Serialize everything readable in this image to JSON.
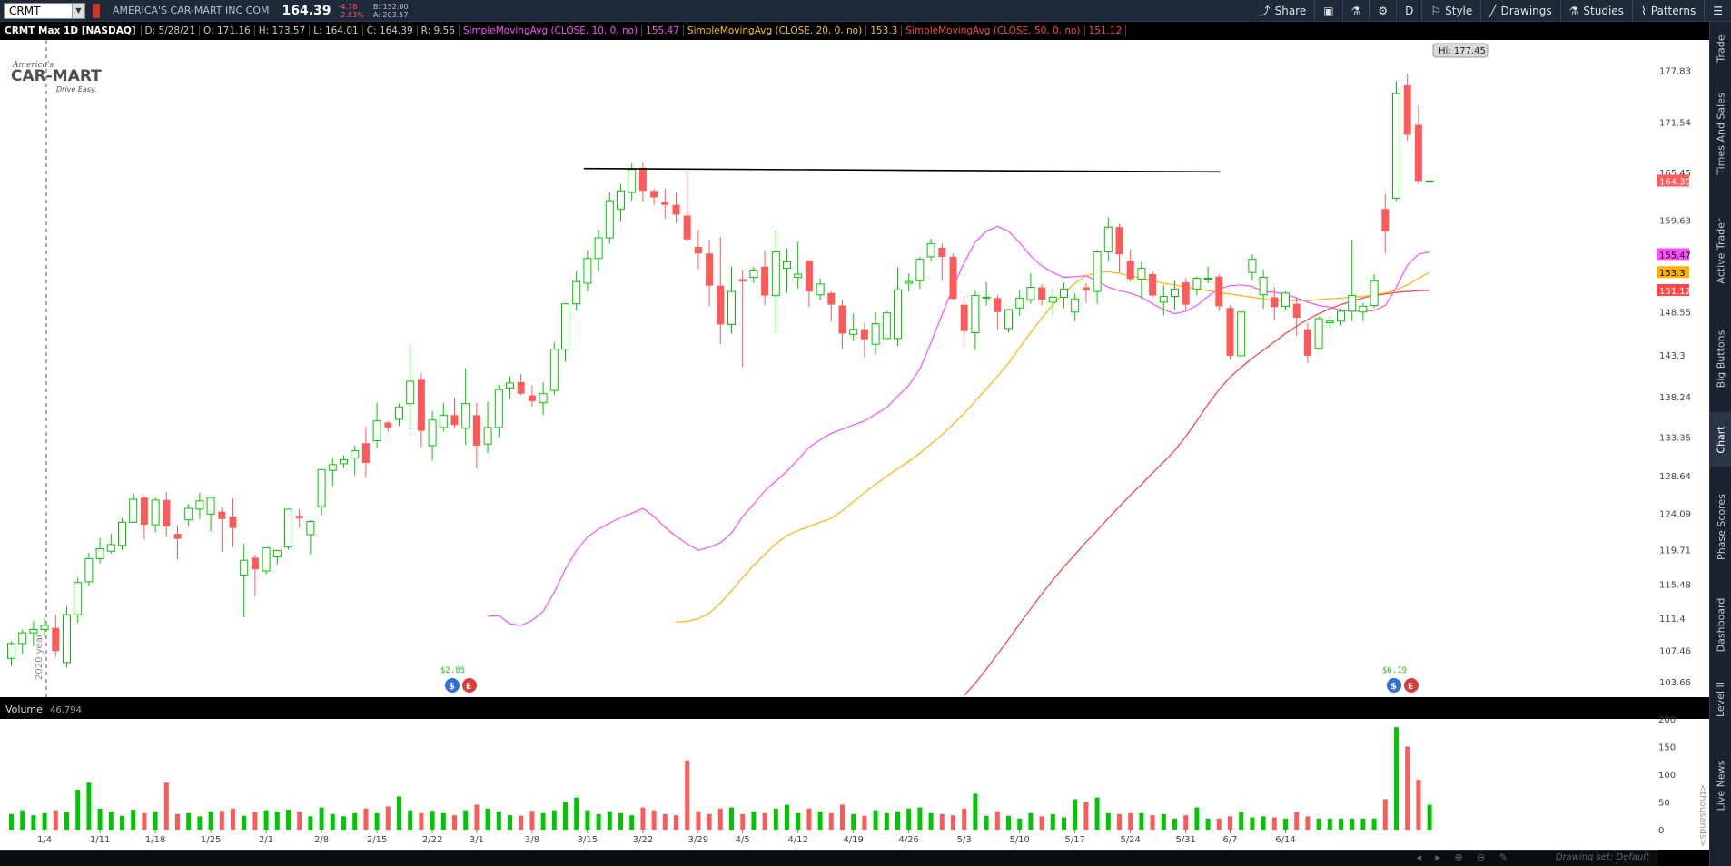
{
  "header": {
    "symbol": "CRMT",
    "company": "AMERICA'S CAR-MART INC COM",
    "last": "164.39",
    "change": "-4.78",
    "change_pct": "-2.83%",
    "bid": "B: 152.00",
    "ask": "A: 203.57"
  },
  "toolbar": [
    {
      "label": "Share",
      "icon": "share-icon"
    },
    {
      "label": "",
      "icon": "camera-icon"
    },
    {
      "label": "",
      "icon": "flask-icon"
    },
    {
      "label": "",
      "icon": "gear-icon"
    },
    {
      "label": "D",
      "icon": ""
    },
    {
      "label": "Style",
      "icon": "style-icon"
    },
    {
      "label": "Drawings",
      "icon": "pencil-icon"
    },
    {
      "label": "Studies",
      "icon": "flask-icon"
    },
    {
      "label": "Patterns",
      "icon": "patterns-icon"
    },
    {
      "label": "",
      "icon": "menu-icon"
    }
  ],
  "study_line": {
    "title": "CRMT Max 1D [NASDAQ]",
    "date": "D: 5/28/21",
    "open": "O: 171.16",
    "high": "H: 173.57",
    "low": "L: 164.01",
    "close": "C: 164.39",
    "range": "R: 9.56",
    "sma10_label": "SimpleMovingAvg (CLOSE, 10, 0, no)",
    "sma10_value": "155.47",
    "sma20_label": "SimpleMovingAvg (CLOSE, 20, 0, no)",
    "sma20_value": "153.3",
    "sma50_label": "SimpleMovingAvg (CLOSE, 50, 0, no)",
    "sma50_value": "151.12"
  },
  "side_tabs": [
    "Trade",
    "Times And Sales",
    "Active Trader",
    "Big Buttons",
    "Chart",
    "Phase Scores",
    "Dashboard",
    "Level II",
    "Live News"
  ],
  "logo": {
    "top": "America's",
    "main": "CAR-MART",
    "tag": "Drive Easy."
  },
  "hi_callout": "Hi: 177.45",
  "year_label": "2020 year",
  "dividend_left": "$2.85",
  "dividend_right": "$6.19",
  "volume_label": "Volume",
  "volume_value": "46,794",
  "volume_unit": "<thousands>",
  "drawing_set": "Drawing set: Default",
  "colors": {
    "up": "#00c800",
    "down": "#ff5a5a",
    "sma10": "#ff4dff",
    "sma20": "#ffb300",
    "sma50": "#ff3c3c"
  },
  "chart_data": {
    "type": "candlestick",
    "price_axis_ticks": [
      177.83,
      171.54,
      165.45,
      159.63,
      153.3,
      148.55,
      143.3,
      138.24,
      133.35,
      128.64,
      124.09,
      119.71,
      115.48,
      111.4,
      107.46,
      103.66
    ],
    "price_ylim": [
      101.8,
      181.5
    ],
    "volume_ticks": [
      200,
      150,
      100,
      50,
      0
    ],
    "volume_ylim": [
      0,
      200
    ],
    "x_ticks": [
      {
        "label": "1/4",
        "i": 3
      },
      {
        "label": "1/11",
        "i": 8
      },
      {
        "label": "1/18",
        "i": 13
      },
      {
        "label": "1/25",
        "i": 18
      },
      {
        "label": "2/1",
        "i": 23
      },
      {
        "label": "2/8",
        "i": 28
      },
      {
        "label": "2/15",
        "i": 33
      },
      {
        "label": "2/22",
        "i": 38
      },
      {
        "label": "3/1",
        "i": 42
      },
      {
        "label": "3/8",
        "i": 47
      },
      {
        "label": "3/15",
        "i": 52
      },
      {
        "label": "3/22",
        "i": 57
      },
      {
        "label": "3/29",
        "i": 62
      },
      {
        "label": "4/5",
        "i": 66
      },
      {
        "label": "4/12",
        "i": 71
      },
      {
        "label": "4/19",
        "i": 76
      },
      {
        "label": "4/26",
        "i": 81
      },
      {
        "label": "5/3",
        "i": 86
      },
      {
        "label": "5/10",
        "i": 91
      },
      {
        "label": "5/17",
        "i": 96
      },
      {
        "label": "5/24",
        "i": 101
      },
      {
        "label": "5/31",
        "i": 106
      },
      {
        "label": "6/7",
        "i": 110
      },
      {
        "label": "6/14",
        "i": 115
      }
    ],
    "candles": [
      [
        106.5,
        108.6,
        105.6,
        108.3,
        28
      ],
      [
        108.3,
        110.0,
        107.0,
        109.6,
        35
      ],
      [
        109.6,
        111.0,
        108.0,
        110.0,
        26
      ],
      [
        110.0,
        111.3,
        109.1,
        110.5,
        30
      ],
      [
        110.2,
        111.8,
        106.7,
        107.4,
        35
      ],
      [
        106.0,
        112.8,
        105.4,
        111.8,
        32
      ],
      [
        111.8,
        116.3,
        110.8,
        115.7,
        72
      ],
      [
        115.8,
        119.3,
        115.3,
        118.6,
        85
      ],
      [
        118.6,
        121.1,
        118.0,
        119.8,
        38
      ],
      [
        119.5,
        121.6,
        119.2,
        120.3,
        33
      ],
      [
        120.2,
        123.5,
        119.6,
        123.0,
        25
      ],
      [
        123.0,
        126.5,
        123.0,
        125.8,
        36
      ],
      [
        126.0,
        126.2,
        120.9,
        122.7,
        30
      ],
      [
        122.7,
        126.0,
        121.8,
        125.7,
        33
      ],
      [
        125.7,
        126.7,
        121.2,
        122.5,
        85
      ],
      [
        121.6,
        122.6,
        118.5,
        121.0,
        28
      ],
      [
        123.3,
        125.2,
        122.5,
        124.7,
        30
      ],
      [
        124.6,
        126.6,
        123.4,
        125.6,
        24
      ],
      [
        124.0,
        126.0,
        121.9,
        126.0,
        33
      ],
      [
        124.3,
        124.8,
        119.4,
        123.4,
        34
      ],
      [
        123.7,
        125.9,
        120.0,
        122.3,
        38
      ],
      [
        116.6,
        120.4,
        111.5,
        118.4,
        25
      ],
      [
        118.7,
        119.1,
        114.0,
        117.3,
        32
      ],
      [
        117.1,
        119.9,
        116.7,
        119.9,
        35
      ],
      [
        118.8,
        119.6,
        117.9,
        119.6,
        33
      ],
      [
        120.0,
        124.6,
        119.7,
        124.6,
        36
      ],
      [
        123.8,
        124.6,
        122.3,
        123.5,
        33
      ],
      [
        121.5,
        123.3,
        119.1,
        123.1,
        24
      ],
      [
        124.9,
        129.4,
        123.9,
        129.4,
        40
      ],
      [
        129.3,
        130.8,
        127.4,
        130.0,
        28
      ],
      [
        130.1,
        131.1,
        129.6,
        130.6,
        24
      ],
      [
        130.8,
        132.3,
        128.7,
        131.7,
        30
      ],
      [
        132.6,
        134.6,
        128.4,
        130.2,
        38
      ],
      [
        132.9,
        137.5,
        132.0,
        135.3,
        30
      ],
      [
        135.1,
        135.3,
        134.0,
        134.5,
        42
      ],
      [
        135.5,
        137.4,
        134.7,
        137.0,
        60
      ],
      [
        137.4,
        144.5,
        134.2,
        140.1,
        35
      ],
      [
        140.3,
        141.1,
        132.1,
        134.1,
        30
      ],
      [
        132.3,
        136.5,
        130.5,
        135.4,
        34
      ],
      [
        134.5,
        137.5,
        134.0,
        136.0,
        30
      ],
      [
        136.0,
        138.1,
        134.4,
        134.8,
        26
      ],
      [
        134.4,
        141.6,
        132.4,
        137.4,
        35
      ],
      [
        136.0,
        137.5,
        129.5,
        132.3,
        45
      ],
      [
        132.5,
        137.6,
        131.4,
        134.5,
        38
      ],
      [
        134.5,
        139.7,
        133.3,
        139.1,
        33
      ],
      [
        139.3,
        140.7,
        138.0,
        139.9,
        26
      ],
      [
        140.0,
        141.0,
        138.4,
        138.6,
        25
      ],
      [
        138.4,
        139.6,
        137.0,
        137.7,
        34
      ],
      [
        137.5,
        140.0,
        136.0,
        138.6,
        30
      ],
      [
        139.0,
        144.8,
        138.5,
        144.0,
        35
      ],
      [
        144.0,
        149.5,
        142.5,
        149.5,
        50
      ],
      [
        149.5,
        153.5,
        148.7,
        152.2,
        58
      ],
      [
        152.0,
        156.0,
        151.0,
        155.0,
        35
      ],
      [
        155.0,
        158.5,
        153.5,
        157.5,
        28
      ],
      [
        157.5,
        163.0,
        156.8,
        162.0,
        33
      ],
      [
        161.0,
        164.0,
        159.5,
        163.2,
        30
      ],
      [
        163.0,
        166.5,
        162.0,
        165.8,
        26
      ],
      [
        166.0,
        166.6,
        161.9,
        163.2,
        40
      ],
      [
        163.2,
        163.5,
        161.5,
        162.4,
        35
      ],
      [
        161.8,
        163.5,
        159.8,
        161.5,
        28
      ],
      [
        161.5,
        163.0,
        159.3,
        160.3,
        26
      ],
      [
        160.2,
        165.6,
        157.1,
        157.3,
        125
      ],
      [
        156.4,
        158.5,
        153.7,
        155.6,
        33
      ],
      [
        155.6,
        157.3,
        149.2,
        151.7,
        28
      ],
      [
        151.7,
        157.6,
        144.6,
        147.0,
        38
      ],
      [
        147.0,
        154.0,
        145.9,
        151.0,
        40
      ],
      [
        152.5,
        153.6,
        141.8,
        152.2,
        28
      ],
      [
        152.7,
        154.0,
        152.0,
        153.6,
        33
      ],
      [
        154.0,
        156.0,
        149.3,
        150.5,
        30
      ],
      [
        150.5,
        158.3,
        146.0,
        155.8,
        38
      ],
      [
        153.8,
        156.2,
        150.8,
        154.6,
        45
      ],
      [
        152.7,
        157.1,
        151.3,
        153.1,
        30
      ],
      [
        154.7,
        154.8,
        149.1,
        151.0,
        38
      ],
      [
        150.6,
        152.6,
        149.9,
        151.9,
        33
      ],
      [
        150.8,
        151.0,
        147.4,
        149.4,
        30
      ],
      [
        149.3,
        150.0,
        144.1,
        145.9,
        45
      ],
      [
        145.8,
        148.3,
        145.0,
        146.4,
        28
      ],
      [
        146.4,
        147.2,
        143.0,
        145.2,
        25
      ],
      [
        144.6,
        148.5,
        143.4,
        147.1,
        35
      ],
      [
        145.3,
        148.6,
        145.3,
        148.4,
        30
      ],
      [
        145.3,
        153.9,
        144.4,
        151.2,
        33
      ],
      [
        152.0,
        153.2,
        151.0,
        152.2,
        38
      ],
      [
        152.3,
        155.2,
        151.3,
        154.9,
        40
      ],
      [
        155.2,
        157.4,
        154.6,
        156.8,
        30
      ],
      [
        156.3,
        156.8,
        152.3,
        155.2,
        28
      ],
      [
        155.2,
        155.6,
        150.0,
        150.1,
        26
      ],
      [
        149.4,
        150.5,
        144.4,
        146.2,
        38
      ],
      [
        146.0,
        151.1,
        143.9,
        150.5,
        65
      ],
      [
        150.2,
        152.1,
        149.3,
        150.3,
        25
      ],
      [
        150.2,
        150.6,
        146.4,
        148.5,
        33
      ],
      [
        146.5,
        148.9,
        146.0,
        148.8,
        25
      ],
      [
        149.0,
        151.1,
        148.0,
        150.2,
        20
      ],
      [
        150.0,
        153.2,
        149.5,
        151.5,
        30
      ],
      [
        151.5,
        151.9,
        149.3,
        150.0,
        24
      ],
      [
        149.7,
        151.4,
        148.2,
        150.3,
        28
      ],
      [
        150.3,
        152.1,
        149.0,
        151.3,
        22
      ],
      [
        148.5,
        150.8,
        147.4,
        150.1,
        55
      ],
      [
        151.5,
        152.0,
        149.6,
        151.1,
        50
      ],
      [
        151.0,
        156.0,
        149.5,
        155.8,
        58
      ],
      [
        155.8,
        160.0,
        154.6,
        158.8,
        30
      ],
      [
        158.8,
        159.2,
        153.3,
        155.5,
        28
      ],
      [
        154.7,
        156.1,
        152.2,
        152.5,
        30
      ],
      [
        152.5,
        154.6,
        150.1,
        153.8,
        30
      ],
      [
        153.1,
        153.5,
        150.3,
        150.5,
        26
      ],
      [
        149.7,
        151.8,
        148.1,
        150.4,
        28
      ],
      [
        150.4,
        152.3,
        148.8,
        151.3,
        20
      ],
      [
        152.1,
        152.6,
        148.7,
        149.4,
        26
      ],
      [
        151.3,
        152.8,
        150.5,
        152.6,
        40
      ],
      [
        152.6,
        154.0,
        152.0,
        152.6,
        20
      ],
      [
        152.8,
        153.1,
        148.6,
        149.2,
        20
      ],
      [
        149.0,
        149.3,
        142.8,
        143.2,
        24
      ],
      [
        143.2,
        148.5,
        143.2,
        148.5,
        32
      ],
      [
        153.3,
        155.5,
        152.3,
        154.9,
        22
      ],
      [
        150.6,
        153.7,
        148.9,
        152.7,
        24
      ],
      [
        150.3,
        151.5,
        147.5,
        149.1,
        22
      ],
      [
        149.2,
        151.0,
        148.7,
        150.8,
        20
      ],
      [
        149.5,
        150.3,
        145.6,
        147.8,
        32
      ],
      [
        146.4,
        147.2,
        142.3,
        143.2,
        24
      ],
      [
        144.1,
        148.0,
        143.9,
        147.7,
        20
      ],
      [
        147.2,
        148.0,
        146.5,
        147.4,
        20
      ],
      [
        147.4,
        148.9,
        146.9,
        148.6,
        20
      ],
      [
        148.6,
        157.3,
        147.4,
        150.5,
        20
      ],
      [
        148.5,
        149.6,
        147.4,
        149.2,
        20
      ],
      [
        149.3,
        153.1,
        149.0,
        152.3,
        20
      ],
      [
        161.0,
        162.8,
        155.6,
        158.3,
        55
      ],
      [
        162.3,
        176.5,
        162.0,
        175.0,
        185
      ],
      [
        176.0,
        177.4,
        169.3,
        170.0,
        150
      ],
      [
        171.2,
        173.6,
        164.0,
        164.4,
        90
      ],
      [
        164.4,
        164.4,
        164.4,
        164.4,
        45
      ]
    ],
    "sma10": [
      111.6,
      111.7,
      110.7,
      110.5,
      111.1,
      112.2,
      114.5,
      117.3,
      119.6,
      121.2,
      122.2,
      122.9,
      123.6,
      124.1,
      124.7,
      123.7,
      122.4,
      121.3,
      120.4,
      119.6,
      120.0,
      120.5,
      121.7,
      123.7,
      125.2,
      126.8,
      128.0,
      129.2,
      130.6,
      132.1,
      133.0,
      133.8,
      134.3,
      134.8,
      135.3,
      136.1,
      136.9,
      138.3,
      139.6,
      141.6,
      144.8,
      148.2,
      151.5,
      154.5,
      157.0,
      158.3,
      158.9,
      158.3,
      156.9,
      155.3,
      154.1,
      153.3,
      152.7,
      152.8,
      152.9,
      152.3,
      151.5,
      151.1,
      150.8,
      150.3,
      149.5,
      148.8,
      148.3,
      148.6,
      149.3,
      150.4,
      151.3,
      151.7,
      151.8,
      151.6,
      151.0,
      150.9,
      150.7,
      150.2,
      149.7,
      149.3,
      149.1,
      148.7,
      148.6,
      148.6,
      148.7,
      149.3,
      151.5,
      154.2,
      155.5,
      155.8
    ],
    "sma20": [
      110.9,
      111.0,
      111.3,
      112.0,
      113.2,
      114.7,
      116.3,
      117.8,
      119.1,
      120.4,
      121.4,
      122.0,
      122.5,
      123.0,
      123.5,
      124.4,
      125.5,
      126.6,
      127.6,
      128.6,
      129.5,
      130.4,
      131.4,
      132.5,
      133.6,
      134.9,
      136.2,
      137.7,
      139.2,
      140.7,
      142.3,
      144.2,
      146.0,
      147.8,
      149.4,
      150.8,
      152.0,
      152.9,
      153.3,
      153.4,
      153.2,
      152.9,
      152.6,
      152.3,
      152.0,
      151.8,
      151.5,
      151.3,
      151.1,
      150.9,
      150.7,
      150.5,
      150.3,
      150.1,
      149.9,
      149.9,
      149.9,
      149.9,
      150.0,
      150.1,
      150.2,
      150.3,
      150.4,
      150.6,
      150.8,
      151.2,
      151.8,
      152.6,
      153.3
    ],
    "sma50": [
      102.0,
      103.5,
      105.2,
      107.0,
      108.8,
      110.7,
      112.5,
      114.3,
      116.0,
      117.6,
      119.1,
      120.6,
      122.0,
      123.5,
      124.9,
      126.3,
      127.6,
      129.0,
      130.3,
      131.7,
      133.4,
      135.3,
      137.3,
      139.1,
      140.6,
      141.8,
      142.9,
      143.9,
      144.9,
      145.9,
      146.8,
      147.6,
      148.3,
      148.9,
      149.4,
      149.8,
      150.2,
      150.5,
      150.7,
      150.9,
      151.0,
      151.1,
      151.12
    ],
    "resistance": {
      "from_i": 52,
      "to_i": 106,
      "value_from": 165.9,
      "value_to": 165.5
    },
    "last_price": 164.39,
    "sma_last": {
      "sma10": 155.47,
      "sma20": 153.3,
      "sma50": 151.12
    }
  }
}
